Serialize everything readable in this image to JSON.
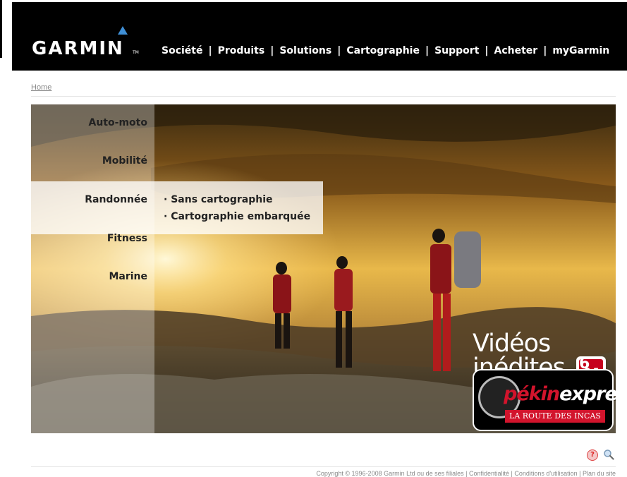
{
  "brand": {
    "name": "GARMIN",
    "tm": "TM",
    "accent_color": "#3f8fd6"
  },
  "nav": {
    "items": [
      {
        "label": "Société"
      },
      {
        "label": "Produits"
      },
      {
        "label": "Solutions"
      },
      {
        "label": "Cartographie"
      },
      {
        "label": "Support"
      },
      {
        "label": "Acheter"
      },
      {
        "label": "myGarmin"
      }
    ],
    "separator": "|"
  },
  "breadcrumb": {
    "home": "Home"
  },
  "categories": [
    {
      "label": "Auto-moto"
    },
    {
      "label": "Mobilité"
    },
    {
      "label": "Randonnée",
      "active": true
    },
    {
      "label": "Fitness"
    },
    {
      "label": "Marine"
    }
  ],
  "submenu": [
    {
      "label": "· Sans cartographie"
    },
    {
      "label": "· Cartographie embarquée"
    }
  ],
  "promo": {
    "line1": "Vidéos",
    "line2": "inédites",
    "channel": "6",
    "channel_letter": "M",
    "show_part1": "pékin",
    "show_part2": "express",
    "show_tagline": "LA ROUTE DES INCAS",
    "show_color": "#d2142c"
  },
  "icons": {
    "help": "?",
    "help_icon": "help-icon",
    "search_icon": "magnifier-icon"
  },
  "footer": {
    "copyright": "Copyright © 1996-2008 Garmin Ltd ou de ses filiales | Confidentialité | Conditions d'utilisation | Plan du site"
  }
}
